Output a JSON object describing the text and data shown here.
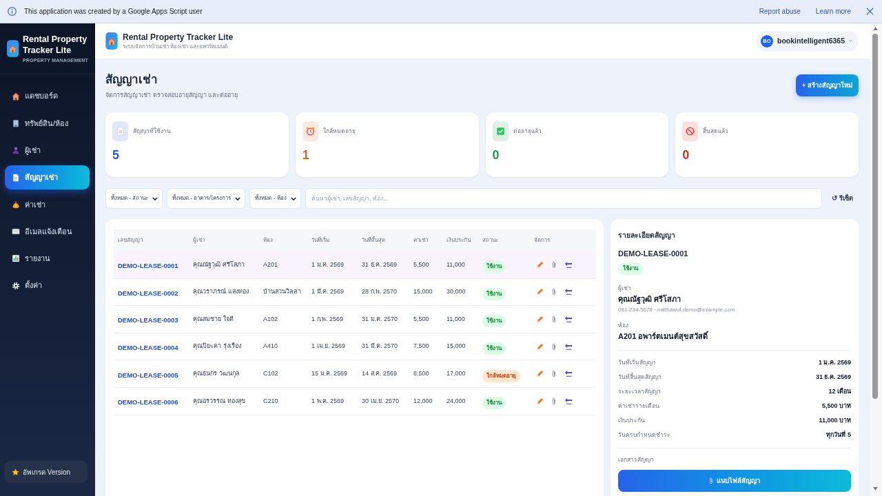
{
  "banner": {
    "message": "This application was created by a Google Apps Script user",
    "links": [
      "Report abuse",
      "Learn more"
    ]
  },
  "sidebar": {
    "app_name": "Rental Property Tracker Lite",
    "tagline": "PROPERTY MANAGEMENT",
    "items": [
      {
        "label": "แดชบอร์ด",
        "selected": false
      },
      {
        "label": "ทรัพย์สิน/ห้อง",
        "selected": false
      },
      {
        "label": "ผู้เช่า",
        "selected": false
      },
      {
        "label": "สัญญาเช่า",
        "selected": true
      },
      {
        "label": "ค่าเช่า",
        "selected": false
      },
      {
        "label": "อีเมลแจ้งเตือน",
        "selected": false
      },
      {
        "label": "รายงาน",
        "selected": false
      },
      {
        "label": "ตั้งค่า",
        "selected": false
      }
    ],
    "upgrade_button": "อัพเกรด Version"
  },
  "header": {
    "title": "Rental Property Tracker Lite",
    "subtitle": "ระบบจัดการบ้านเช่า ห้องเช่า และอพาร์ตเมนต์",
    "user": {
      "initials": "BO",
      "name": "bookintelligent6365"
    }
  },
  "page": {
    "title": "สัญญาเช่า",
    "subtitle": "จัดการสัญญาเช่า ตรวจสอบอายุสัญญา และต่ออายุ",
    "create_button": "+ สร้างสัญญาใหม่"
  },
  "stats": [
    {
      "label": "สัญญาที่ใช้งาน",
      "value": "5",
      "color": "#2a5bd7"
    },
    {
      "label": "ใกล้หมดอายุ",
      "value": "1",
      "color": "#e0621d"
    },
    {
      "label": "ต่ออายุแล้ว",
      "value": "0",
      "color": "#1f9d55"
    },
    {
      "label": "สิ้นสุดแล้ว",
      "value": "0",
      "color": "#d92d20"
    }
  ],
  "filters": {
    "selects": [
      "ทั้งหมด - สถานะ",
      "ทั้งหมด - อาคาร/โครงการ",
      "ทั้งหมด - ห้อง"
    ],
    "search": {
      "placeholder": "ค้นหาผู้เช่า, เลขสัญญา, ห้อง..."
    },
    "reset_button": "↺ รีเซ็ต"
  },
  "table": {
    "columns": [
      "เลขสัญญา",
      "ผู้เช่า",
      "ห้อง",
      "วันที่เริ่ม",
      "วันที่สิ้นสุด",
      "ค่าเช่า",
      "เงินประกัน",
      "สถานะ",
      "จัดการ"
    ],
    "rows": [
      {
        "lease_no": "DEMO-LEASE-0001",
        "tenant": "คุณณัฐวุฒิ ศรีโสภา",
        "room": "A201",
        "start": "1 ม.ค. 2569",
        "end": "31 ธ.ค. 2569",
        "rent": "5,500",
        "deposit": "11,000",
        "status": {
          "label": "ใช้งาน",
          "kind": "active"
        },
        "selected": true
      },
      {
        "lease_no": "DEMO-LEASE-0002",
        "tenant": "คุณวราภรณ์ แสงทอง",
        "room": "บ้านสวนวิลล่า",
        "start": "1 มี.ค. 2569",
        "end": "28 ก.พ. 2570",
        "rent": "15,000",
        "deposit": "30,000",
        "status": {
          "label": "ใช้งาน",
          "kind": "active"
        },
        "selected": false
      },
      {
        "lease_no": "DEMO-LEASE-0003",
        "tenant": "คุณสมชาย ใจดี",
        "room": "A102",
        "start": "1 ก.พ. 2569",
        "end": "31 ม.ค. 2570",
        "rent": "5,500",
        "deposit": "11,000",
        "status": {
          "label": "ใช้งาน",
          "kind": "active"
        },
        "selected": false
      },
      {
        "lease_no": "DEMO-LEASE-0004",
        "tenant": "คุณปิยะดา รุ่งเรือง",
        "room": "A410",
        "start": "1 เม.ย. 2569",
        "end": "31 มี.ค. 2570",
        "rent": "7,500",
        "deposit": "15,000",
        "status": {
          "label": "ใช้งาน",
          "kind": "active"
        },
        "selected": false
      },
      {
        "lease_no": "DEMO-LEASE-0005",
        "tenant": "คุณธนกร วัฒนกุล",
        "room": "C102",
        "start": "15 ม.ค. 2569",
        "end": "14 ส.ค. 2569",
        "rent": "8,500",
        "deposit": "17,000",
        "status": {
          "label": "ใกล้หมดอายุ",
          "kind": "expiring"
        },
        "selected": false
      },
      {
        "lease_no": "DEMO-LEASE-0006",
        "tenant": "คุณอรวรรณ ทองสุข",
        "room": "C210",
        "start": "1 พ.ค. 2569",
        "end": "30 เม.ย. 2570",
        "rent": "12,000",
        "deposit": "24,000",
        "status": {
          "label": "ใช้งาน",
          "kind": "active"
        },
        "selected": false
      }
    ]
  },
  "detail": {
    "title": "รายละเอียดสัญญา",
    "lease_no": "DEMO-LEASE-0001",
    "status": {
      "label": "ใช้งาน",
      "kind": "active"
    },
    "tenant_label": "ผู้เช่า",
    "tenant_name": "คุณณัฐวุฒิ ศรีโสภา",
    "tenant_contact": "081-234-5678 · natthawut.demo@example.com",
    "room_label": "ห้อง",
    "room": "**A201** อพาร์ตเมนต์สุขสวัสดิ์",
    "fields": [
      {
        "label": "วันที่เริ่มสัญญา",
        "value": "1 ม.ค. 2569"
      },
      {
        "label": "วันที่สิ้นสุดสัญญา",
        "value": "31 ธ.ค. 2569"
      },
      {
        "label": "ระยะเวลาสัญญา",
        "value": "12 เดือน"
      },
      {
        "label": "ค่าเช่ารายเดือน",
        "value": "5,500 บาท"
      },
      {
        "label": "เงินประกัน",
        "value": "11,000 บาท"
      },
      {
        "label": "วันครบกำหนดชำระ",
        "value": "ทุกวันที่ 5"
      }
    ],
    "documents_label": "เอกสารสัญญา",
    "attach_button": "แนบไฟล์สัญญา"
  }
}
